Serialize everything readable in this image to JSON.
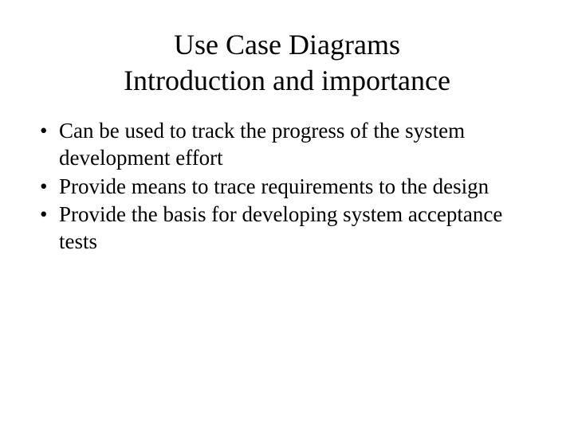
{
  "title": {
    "line1": "Use Case Diagrams",
    "line2": "Introduction and importance"
  },
  "bullets": [
    " Can be used to track the progress of the system development effort",
    "Provide means to trace requirements to the design",
    "Provide the basis for developing system acceptance tests"
  ]
}
